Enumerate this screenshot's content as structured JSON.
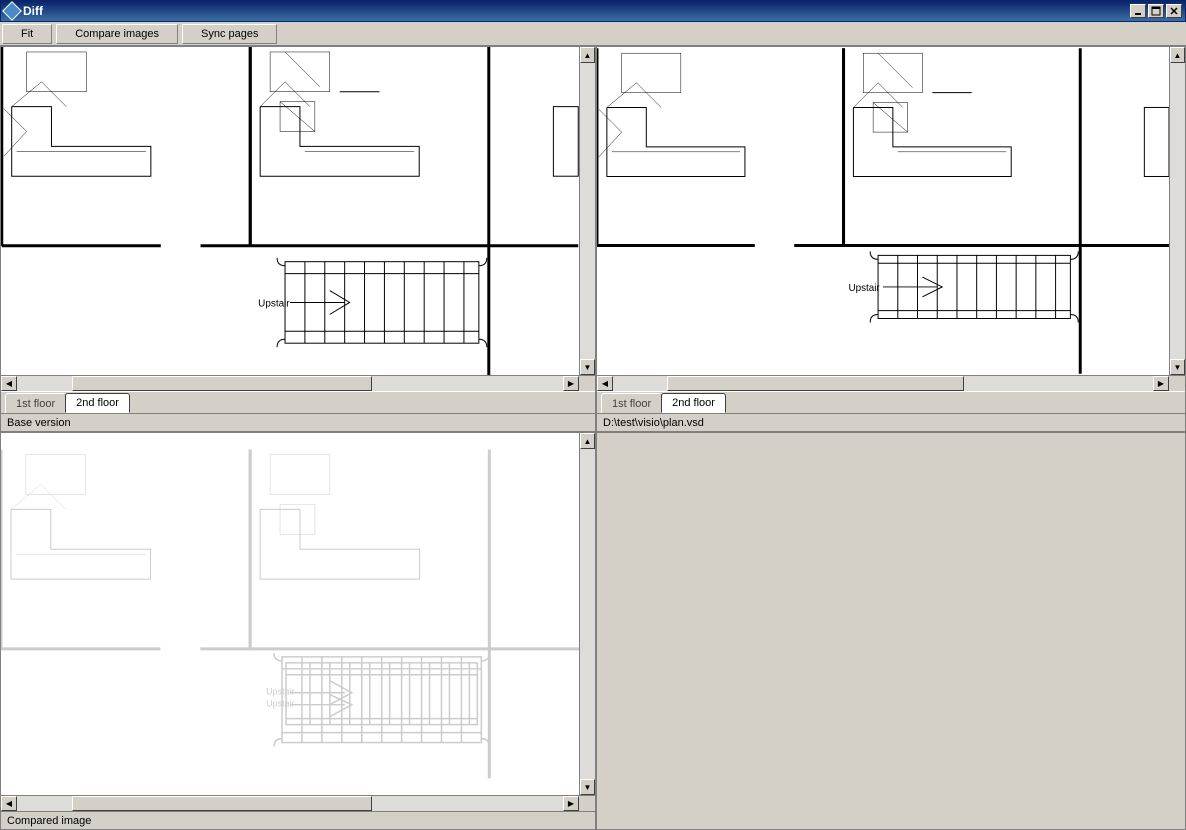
{
  "window": {
    "title": "Diff"
  },
  "toolbar": {
    "fit": "Fit",
    "compare": "Compare images",
    "sync": "Sync pages"
  },
  "panes": {
    "tabs": {
      "first_floor": "1st floor",
      "second_floor": "2nd floor"
    },
    "top_left_label": "Base version",
    "top_right_path": "D:\\test\\visio\\plan.vsd",
    "bottom_left_label": "Compared image"
  },
  "plan": {
    "upstair_label": "Upstair"
  }
}
